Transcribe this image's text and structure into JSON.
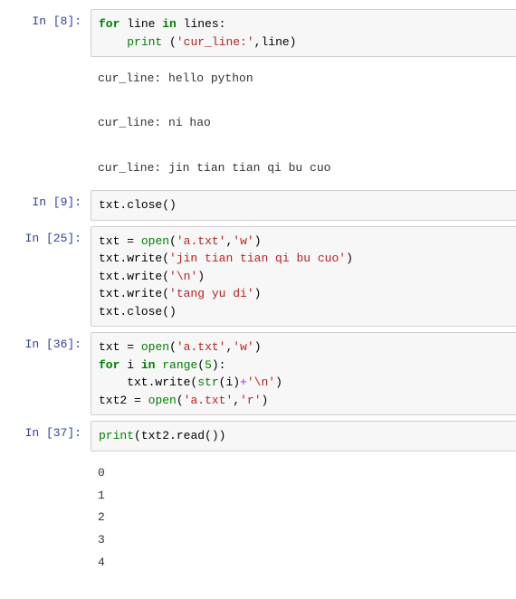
{
  "cells": [
    {
      "prompt": "In  [8]:",
      "tokens": [
        {
          "t": "for",
          "c": "k-green"
        },
        {
          "t": " "
        },
        {
          "t": "line "
        },
        {
          "t": "in",
          "c": "k-green"
        },
        {
          "t": " lines:"
        },
        {
          "t": "\n    "
        },
        {
          "t": "print",
          "c": "k-builtin"
        },
        {
          "t": " ("
        },
        {
          "t": "'cur_line:'",
          "c": "k-str"
        },
        {
          "t": ",line)"
        }
      ],
      "output": "cur_line: hello python\n\ncur_line: ni hao\n\ncur_line: jin tian tian qi bu cuo\n"
    },
    {
      "prompt": "In  [9]:",
      "tokens": [
        {
          "t": "txt"
        },
        {
          "t": "."
        },
        {
          "t": "close()"
        }
      ]
    },
    {
      "prompt": "In [25]:",
      "tokens": [
        {
          "t": "txt "
        },
        {
          "t": "="
        },
        {
          "t": " "
        },
        {
          "t": "open",
          "c": "k-builtin"
        },
        {
          "t": "("
        },
        {
          "t": "'a.txt'",
          "c": "k-str"
        },
        {
          "t": ","
        },
        {
          "t": "'w'",
          "c": "k-str"
        },
        {
          "t": ")"
        },
        {
          "t": "\n"
        },
        {
          "t": "txt"
        },
        {
          "t": "."
        },
        {
          "t": "write("
        },
        {
          "t": "'jin tian tian qi bu cuo'",
          "c": "k-str"
        },
        {
          "t": ")"
        },
        {
          "t": "\n"
        },
        {
          "t": "txt"
        },
        {
          "t": "."
        },
        {
          "t": "write("
        },
        {
          "t": "'",
          "c": "k-str"
        },
        {
          "t": "\\n",
          "c": "k-str"
        },
        {
          "t": "'",
          "c": "k-str"
        },
        {
          "t": ")"
        },
        {
          "t": "\n"
        },
        {
          "t": "txt"
        },
        {
          "t": "."
        },
        {
          "t": "write("
        },
        {
          "t": "'tang yu di'",
          "c": "k-str"
        },
        {
          "t": ")"
        },
        {
          "t": "\n"
        },
        {
          "t": "txt"
        },
        {
          "t": "."
        },
        {
          "t": "close()"
        }
      ]
    },
    {
      "prompt": "In [36]:",
      "tokens": [
        {
          "t": "txt "
        },
        {
          "t": "="
        },
        {
          "t": " "
        },
        {
          "t": "open",
          "c": "k-builtin"
        },
        {
          "t": "("
        },
        {
          "t": "'a.txt'",
          "c": "k-str"
        },
        {
          "t": ","
        },
        {
          "t": "'w'",
          "c": "k-str"
        },
        {
          "t": ")"
        },
        {
          "t": "\n"
        },
        {
          "t": "for",
          "c": "k-green"
        },
        {
          "t": " i "
        },
        {
          "t": "in",
          "c": "k-green"
        },
        {
          "t": " "
        },
        {
          "t": "range",
          "c": "k-builtin"
        },
        {
          "t": "("
        },
        {
          "t": "5",
          "c": "k-num"
        },
        {
          "t": "):"
        },
        {
          "t": "\n    txt"
        },
        {
          "t": "."
        },
        {
          "t": "write("
        },
        {
          "t": "str",
          "c": "k-builtin"
        },
        {
          "t": "(i)"
        },
        {
          "t": "+",
          "c": "k-purple"
        },
        {
          "t": "'",
          "c": "k-str"
        },
        {
          "t": "\\n",
          "c": "k-str"
        },
        {
          "t": "'",
          "c": "k-str"
        },
        {
          "t": ")"
        },
        {
          "t": "\n"
        },
        {
          "t": "txt2 "
        },
        {
          "t": "="
        },
        {
          "t": " "
        },
        {
          "t": "open",
          "c": "k-builtin"
        },
        {
          "t": "("
        },
        {
          "t": "'a.txt'",
          "c": "k-str"
        },
        {
          "t": ","
        },
        {
          "t": "'r'",
          "c": "k-str"
        },
        {
          "t": ")"
        }
      ]
    },
    {
      "prompt": "In [37]:",
      "tokens": [
        {
          "t": "print",
          "c": "k-builtin"
        },
        {
          "t": "(txt2"
        },
        {
          "t": "."
        },
        {
          "t": "read())"
        }
      ],
      "output": "0\n1\n2\n3\n4"
    }
  ]
}
